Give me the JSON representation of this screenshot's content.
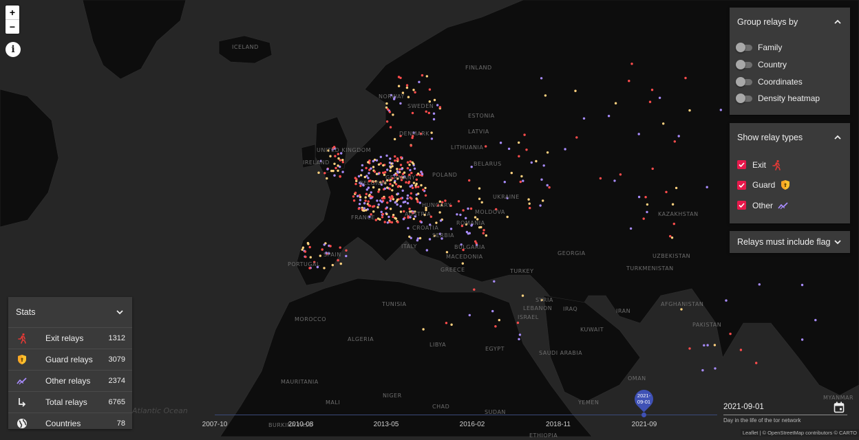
{
  "map": {
    "labels": [
      {
        "text": "ICELAND"
      },
      {
        "text": "NORWAY"
      },
      {
        "text": "SWEDEN"
      },
      {
        "text": "FINLAND"
      },
      {
        "text": "ESTONIA"
      },
      {
        "text": "LATVIA"
      },
      {
        "text": "LITHUANIA"
      },
      {
        "text": "UNITED KINGDOM"
      },
      {
        "text": "BELARUS"
      },
      {
        "text": "POLAND"
      },
      {
        "text": "UKRAINE"
      },
      {
        "text": "FRANCE"
      },
      {
        "text": "ROMANIA"
      },
      {
        "text": "PORTUGAL"
      },
      {
        "text": "TURKEY"
      },
      {
        "text": "GEORGIA"
      },
      {
        "text": "KAZAKHSTAN"
      },
      {
        "text": "UZBEKISTAN"
      },
      {
        "text": "TURKMENISTAN"
      },
      {
        "text": "SYRIA"
      },
      {
        "text": "IRAQ"
      },
      {
        "text": "IRAN"
      },
      {
        "text": "AFGHANISTAN"
      },
      {
        "text": "PAKISTAN"
      },
      {
        "text": "TUNISIA"
      },
      {
        "text": "MOROCCO"
      },
      {
        "text": "ALGERIA"
      },
      {
        "text": "LIBYA"
      },
      {
        "text": "EGYPT"
      },
      {
        "text": "SAUDI ARABIA"
      },
      {
        "text": "OMAN"
      },
      {
        "text": "YEMEN"
      },
      {
        "text": "MAURITANIA"
      },
      {
        "text": "MALI"
      },
      {
        "text": "NIGER"
      },
      {
        "text": "CHAD"
      },
      {
        "text": "SUDAN"
      },
      {
        "text": "ETHIOPIA"
      },
      {
        "text": "BURKINA FASO"
      },
      {
        "text": "MYANMAR"
      },
      {
        "text": "ITALY"
      },
      {
        "text": "AUSTRIA"
      },
      {
        "text": "HUNGARY"
      },
      {
        "text": "BULGARIA"
      },
      {
        "text": "KUWAIT"
      },
      {
        "text": "SPAIN"
      },
      {
        "text": "GREECE"
      },
      {
        "text": "CROATIA"
      },
      {
        "text": "DENMARK"
      },
      {
        "text": "IRELAND"
      },
      {
        "text": "BELGIUM"
      },
      {
        "text": "GERMANY"
      },
      {
        "text": "MACEDONIA"
      },
      {
        "text": "SERBIA"
      },
      {
        "text": "MOLDOVA"
      },
      {
        "text": "ISRAEL"
      },
      {
        "text": "LEBANON"
      }
    ],
    "ocean_label": "Atlantic Ocean",
    "relay_colors": {
      "exit": "#ff4d4d",
      "guard": "#ffd27f",
      "other": "#a78bfa"
    },
    "zoom_in": "+",
    "zoom_out": "−",
    "info_glyph": "i"
  },
  "group_panel": {
    "title": "Group relays by",
    "options": [
      {
        "label": "Family",
        "on": false
      },
      {
        "label": "Country",
        "on": false
      },
      {
        "label": "Coordinates",
        "on": false
      },
      {
        "label": "Density heatmap",
        "on": false
      }
    ]
  },
  "types_panel": {
    "title": "Show relay types",
    "types": [
      {
        "label": "Exit",
        "checked": true,
        "icon": "running-person-icon",
        "color": "#e53935"
      },
      {
        "label": "Guard",
        "checked": true,
        "icon": "shield-icon",
        "color": "#fbc02d"
      },
      {
        "label": "Other",
        "checked": true,
        "icon": "trend-line-icon",
        "color": "#a78bfa"
      }
    ]
  },
  "flag_panel": {
    "title": "Relays must include flag"
  },
  "stats": {
    "title": "Stats",
    "rows": [
      {
        "label": "Exit relays",
        "value": "1312",
        "icon": "running-person-icon"
      },
      {
        "label": "Guard relays",
        "value": "3079",
        "icon": "shield-icon"
      },
      {
        "label": "Other relays",
        "value": "2374",
        "icon": "trend-line-icon"
      },
      {
        "label": "Total relays",
        "value": "6765",
        "icon": "sum-arrow-icon"
      },
      {
        "label": "Countries",
        "value": "78",
        "icon": "globe-icon"
      }
    ]
  },
  "timeline": {
    "ticks": [
      "2007-10",
      "2010-08",
      "2013-05",
      "2016-02",
      "2018-11",
      "2021-09"
    ],
    "selected_pin": "2021-09-01"
  },
  "date_picker": {
    "value": "2021-09-01",
    "hint": "Day in the life of the tor network"
  },
  "attribution": "Leaflet | © OpenStreetMap contributors © CARTO"
}
